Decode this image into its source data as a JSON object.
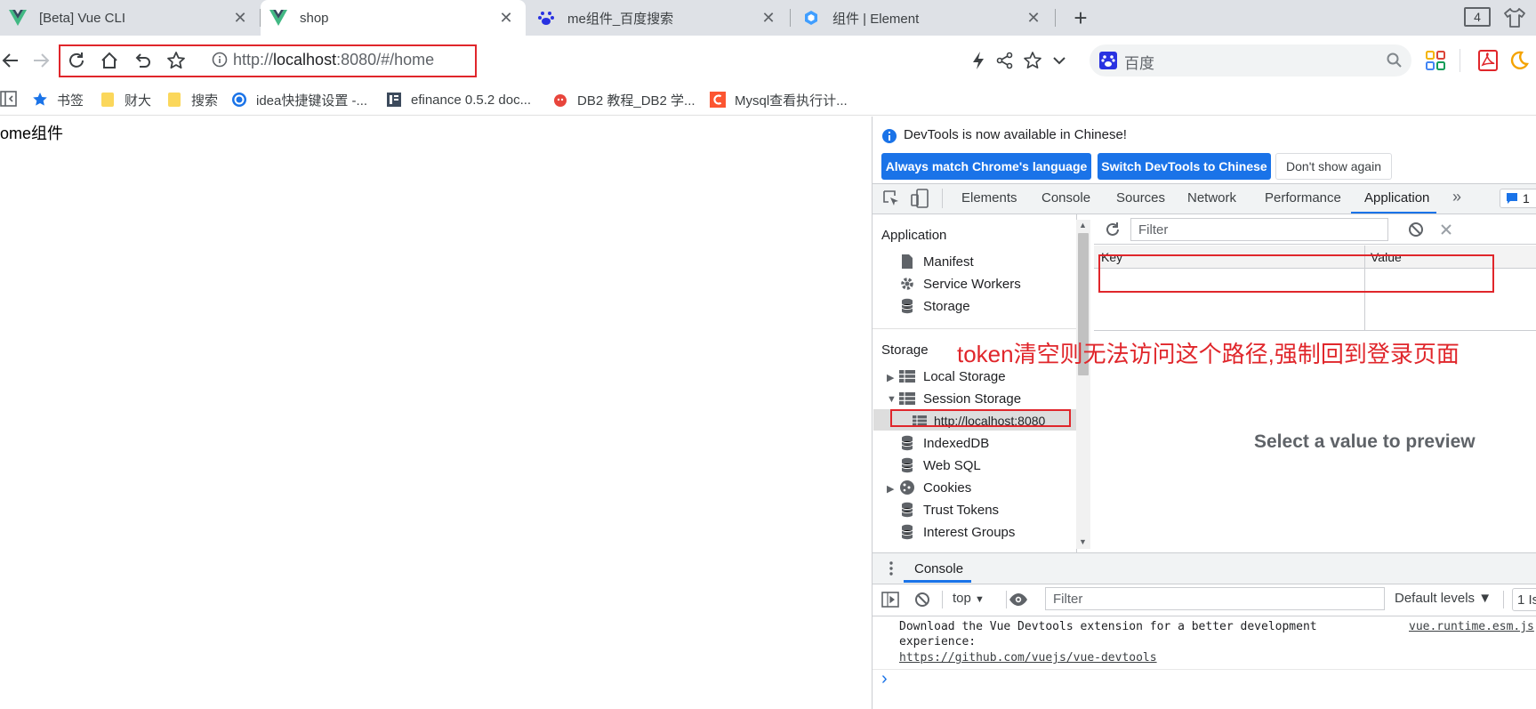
{
  "browser": {
    "tabs": [
      {
        "label": "[Beta] Vue CLI",
        "icon": "vue-icon",
        "active": false
      },
      {
        "label": "shop",
        "icon": "vue-icon",
        "active": true
      },
      {
        "label": "me组件_百度搜索",
        "icon": "baidu-icon",
        "active": false
      },
      {
        "label": "组件 | Element",
        "icon": "element-icon",
        "active": false
      }
    ],
    "tab_counter": "4",
    "close_glyph": "✕",
    "new_tab_glyph": "+",
    "address": {
      "scheme": "http://",
      "host": "localhost",
      "rest": ":8080/#/home"
    },
    "search_engine_label": "百度",
    "bookmarks": [
      {
        "label": "书签",
        "icon": "star-icon"
      },
      {
        "label": "财大",
        "icon": "folder-icon"
      },
      {
        "label": "搜索",
        "icon": "folder-icon"
      },
      {
        "label": "idea快捷键设置 -...",
        "icon": "site-icon"
      },
      {
        "label": "efinance 0.5.2 doc...",
        "icon": "doc-icon"
      },
      {
        "label": "DB2 教程_DB2 学...",
        "icon": "db2-icon"
      },
      {
        "label": "Mysql查看执行计...",
        "icon": "csdn-icon"
      }
    ]
  },
  "page": {
    "text": "ome组件"
  },
  "devtools": {
    "info_message": "DevTools is now available in Chinese!",
    "buttons": {
      "match_language": "Always match Chrome's language",
      "switch_chinese": "Switch DevTools to Chinese",
      "dont_show": "Don't show again"
    },
    "tabs": [
      "Elements",
      "Console",
      "Sources",
      "Network",
      "Performance",
      "Application"
    ],
    "active_tab": "Application",
    "more_glyph": "»",
    "issues_count": "1",
    "sidebar": {
      "application_heading": "Application",
      "application_items": [
        "Manifest",
        "Service Workers",
        "Storage"
      ],
      "storage_heading": "Storage",
      "storage_items": [
        "Local Storage",
        "Session Storage",
        "http://localhost:8080",
        "IndexedDB",
        "Web SQL",
        "Cookies",
        "Trust Tokens",
        "Interest Groups"
      ]
    },
    "storage_view": {
      "filter_placeholder": "Filter",
      "columns": [
        "Key",
        "Value"
      ],
      "preview_text": "Select a value to preview"
    },
    "drawer": {
      "tab_label": "Console",
      "context": "top",
      "context_caret": "▼",
      "filter_placeholder": "Filter",
      "levels": "Default levels ▼",
      "issues": "1 Is",
      "message_line1": "Download the Vue Devtools extension for a better development",
      "message_line2": "experience:",
      "message_link": "https://github.com/vuejs/vue-devtools",
      "message_source": "vue.runtime.esm.js",
      "prompt_glyph": "›"
    }
  },
  "annotation": {
    "text": "token清空则无法访问这个路径,强制回到登录页面",
    "color": "#e0262b"
  },
  "colors": {
    "accent": "#1a73e8",
    "annotation_red": "#e0262b",
    "tab_strip": "#dee1e6"
  }
}
